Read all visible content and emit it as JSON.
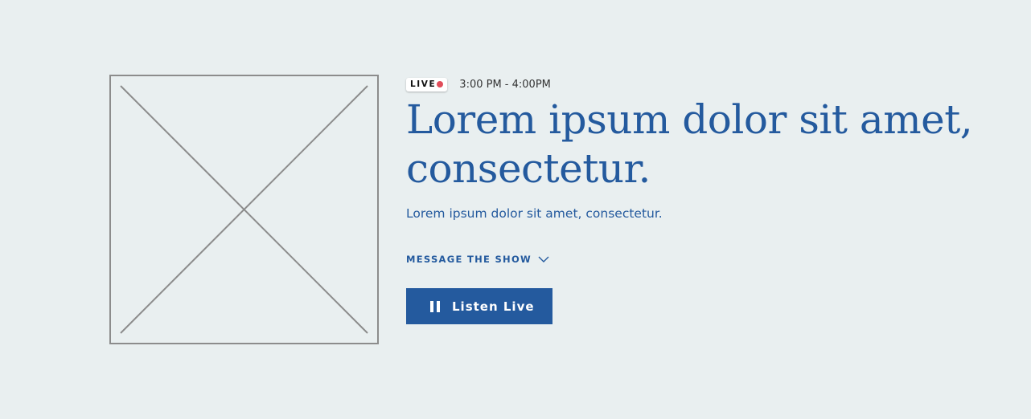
{
  "colors": {
    "background": "#e9eff0",
    "primary": "#245a9e",
    "live_dot": "#e14d5a",
    "placeholder_stroke": "#8c8c8c"
  },
  "hero": {
    "image_placeholder": "image-placeholder",
    "live_label": "LIVE",
    "time_range": "3:00 PM - 4:00PM",
    "headline": "Lorem ipsum dolor sit amet, consectetur.",
    "subtitle": "Lorem ipsum dolor sit amet, consectetur.",
    "message_toggle_label": "MESSAGE THE SHOW",
    "message_toggle_icon": "chevron-down-icon",
    "listen_button_label": "Listen Live",
    "listen_button_icon": "pause-icon"
  }
}
